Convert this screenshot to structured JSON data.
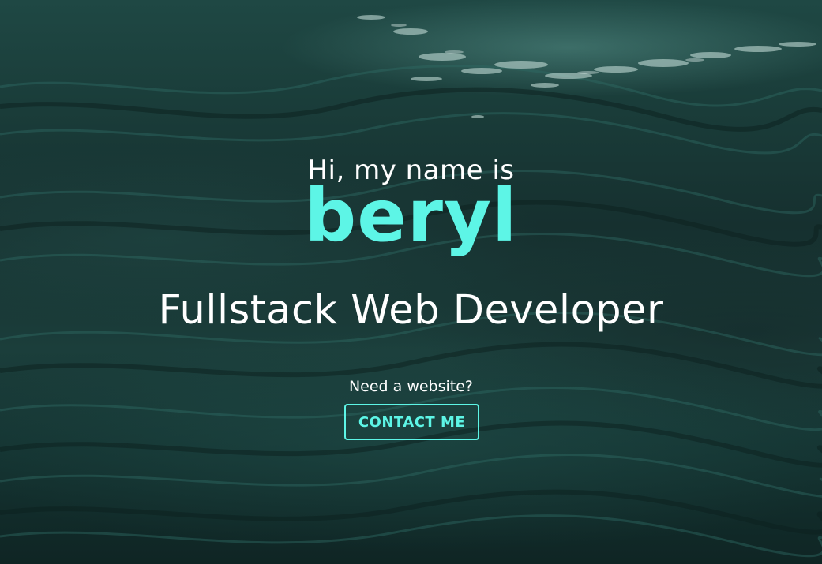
{
  "hero": {
    "greeting": "Hi, my name is",
    "name": "beryl",
    "role": "Fullstack Web Developer",
    "prompt": "Need a website?",
    "contact_label": "CONTACT ME"
  },
  "colors": {
    "accent": "#5df5e6",
    "text": "#ffffff",
    "background": "#1a3d3a"
  }
}
